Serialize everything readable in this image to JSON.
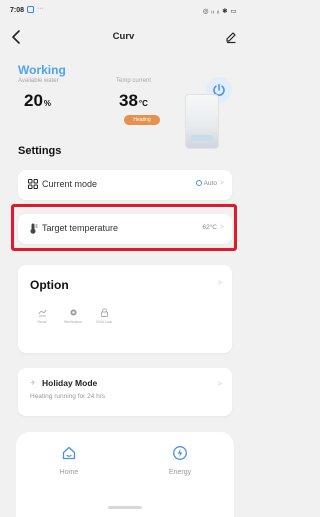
{
  "status_bar": {
    "time": "7:08",
    "dots": "···",
    "right_icons": "◎ ᵢᵢ ᵢᵢ ✱ ▭"
  },
  "header": {
    "title": "Curv"
  },
  "overview": {
    "status": "Working",
    "water_label": "Available water",
    "water_value": "20",
    "water_unit": "%",
    "temp_label": "Temp current",
    "temp_value": "38",
    "temp_unit": "°C",
    "badge": "Heating",
    "accent_color": "#4fa3f0",
    "badge_color": "#e8904e"
  },
  "settings": {
    "title": "Settings",
    "current_mode": {
      "label": "Current mode",
      "value": "Auto"
    },
    "target_temperature": {
      "label": "Target temperature",
      "value": "62°C"
    }
  },
  "option": {
    "title": "Option",
    "items": [
      "Boost",
      "Sterilization",
      "Child Lock"
    ]
  },
  "holiday": {
    "title": "Holiday Mode",
    "subtitle": "Heating running for 24 hrs"
  },
  "nav": {
    "home": "Home",
    "energy": "Energy"
  },
  "highlight_color": "#e01a2a"
}
